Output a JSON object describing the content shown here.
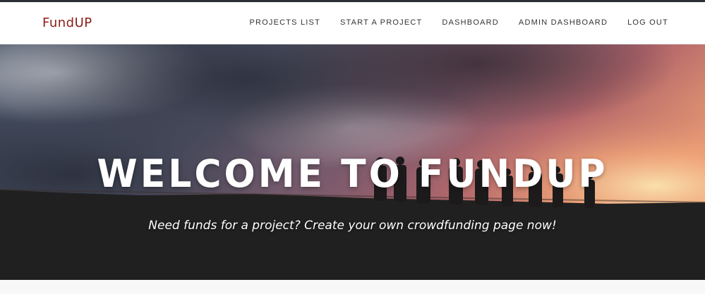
{
  "app": {
    "brand": "FundUP",
    "brand_color": "#8c1d18"
  },
  "nav": {
    "items": [
      {
        "label": "PROJECTS LIST"
      },
      {
        "label": "START A PROJECT"
      },
      {
        "label": "DASHBOARD"
      },
      {
        "label": "ADMIN DASHBOARD"
      },
      {
        "label": "LOG OUT"
      }
    ]
  },
  "hero": {
    "title": "WELCOME TO FUNDUP",
    "subtitle": "Need funds for a project? Create your own crowdfunding page now!",
    "background": "sunset-silhouette-crowd"
  }
}
